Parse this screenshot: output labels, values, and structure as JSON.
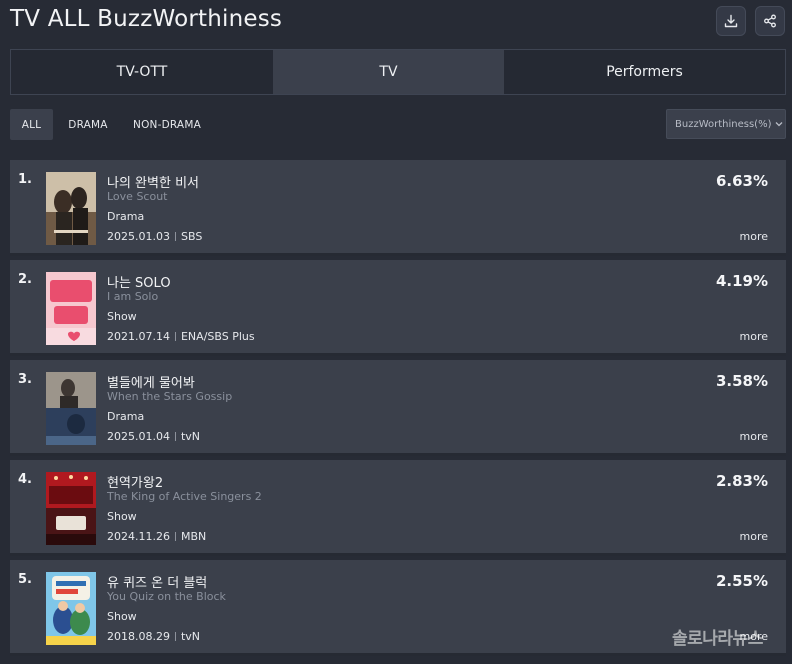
{
  "header": {
    "title": "TV ALL BuzzWorthiness",
    "download_icon": "download-icon",
    "share_icon": "share-icon"
  },
  "tabs": [
    {
      "label": "TV-OTT",
      "active": false
    },
    {
      "label": "TV",
      "active": true
    },
    {
      "label": "Performers",
      "active": false
    }
  ],
  "filters": [
    {
      "label": "ALL",
      "active": true
    },
    {
      "label": "DRAMA",
      "active": false
    },
    {
      "label": "NON-DRAMA",
      "active": false
    }
  ],
  "sort": {
    "label": "BuzzWorthiness(%)",
    "icon": "chevron-down-icon"
  },
  "rankings": [
    {
      "rank": "1.",
      "title_ko": "나의 완벽한 비서",
      "title_en": "Love Scout",
      "genre": "Drama",
      "date": "2025.01.03",
      "channel": "SBS",
      "percent": "6.63%",
      "more": "more"
    },
    {
      "rank": "2.",
      "title_ko": "나는 SOLO",
      "title_en": "I am Solo",
      "genre": "Show",
      "date": "2021.07.14",
      "channel": "ENA/SBS Plus",
      "percent": "4.19%",
      "more": "more"
    },
    {
      "rank": "3.",
      "title_ko": "별들에게 물어봐",
      "title_en": "When the Stars Gossip",
      "genre": "Drama",
      "date": "2025.01.04",
      "channel": "tvN",
      "percent": "3.58%",
      "more": "more"
    },
    {
      "rank": "4.",
      "title_ko": "현역가왕2",
      "title_en": "The King of Active Singers 2",
      "genre": "Show",
      "date": "2024.11.26",
      "channel": "MBN",
      "percent": "2.83%",
      "more": "more"
    },
    {
      "rank": "5.",
      "title_ko": "유 퀴즈 온 더 블럭",
      "title_en": "You Quiz on the Block",
      "genre": "Show",
      "date": "2018.08.29",
      "channel": "tvN",
      "percent": "2.55%",
      "more": "more"
    }
  ],
  "watermark": "솔로나라뉴스",
  "colors": {
    "background": "#272b35",
    "row": "#3b404b",
    "active_tab": "#3b404c"
  }
}
